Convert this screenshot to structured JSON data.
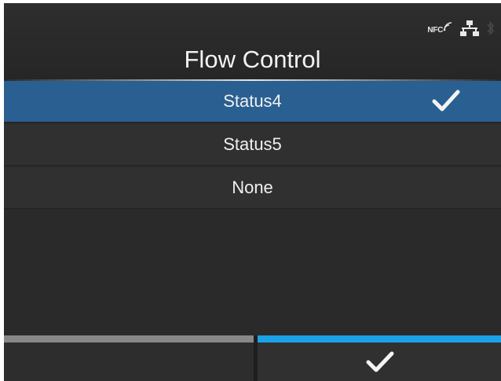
{
  "header": {
    "title": "Flow Control",
    "status_icons": {
      "nfc_label": "NFC",
      "icons": [
        "nfc-icon",
        "network-icon",
        "bluetooth-icon"
      ]
    }
  },
  "options": [
    {
      "label": "Status4",
      "selected": true
    },
    {
      "label": "Status5",
      "selected": false
    },
    {
      "label": "None",
      "selected": false
    }
  ],
  "footer": {
    "left_softkey": {
      "label": "",
      "bar_color": "#888888"
    },
    "right_softkey": {
      "icon": "check-icon",
      "bar_color": "#1aa3e6"
    }
  },
  "colors": {
    "selected_row": "#2a5f92",
    "background": "#2a2a2a",
    "accent": "#1aa3e6"
  }
}
